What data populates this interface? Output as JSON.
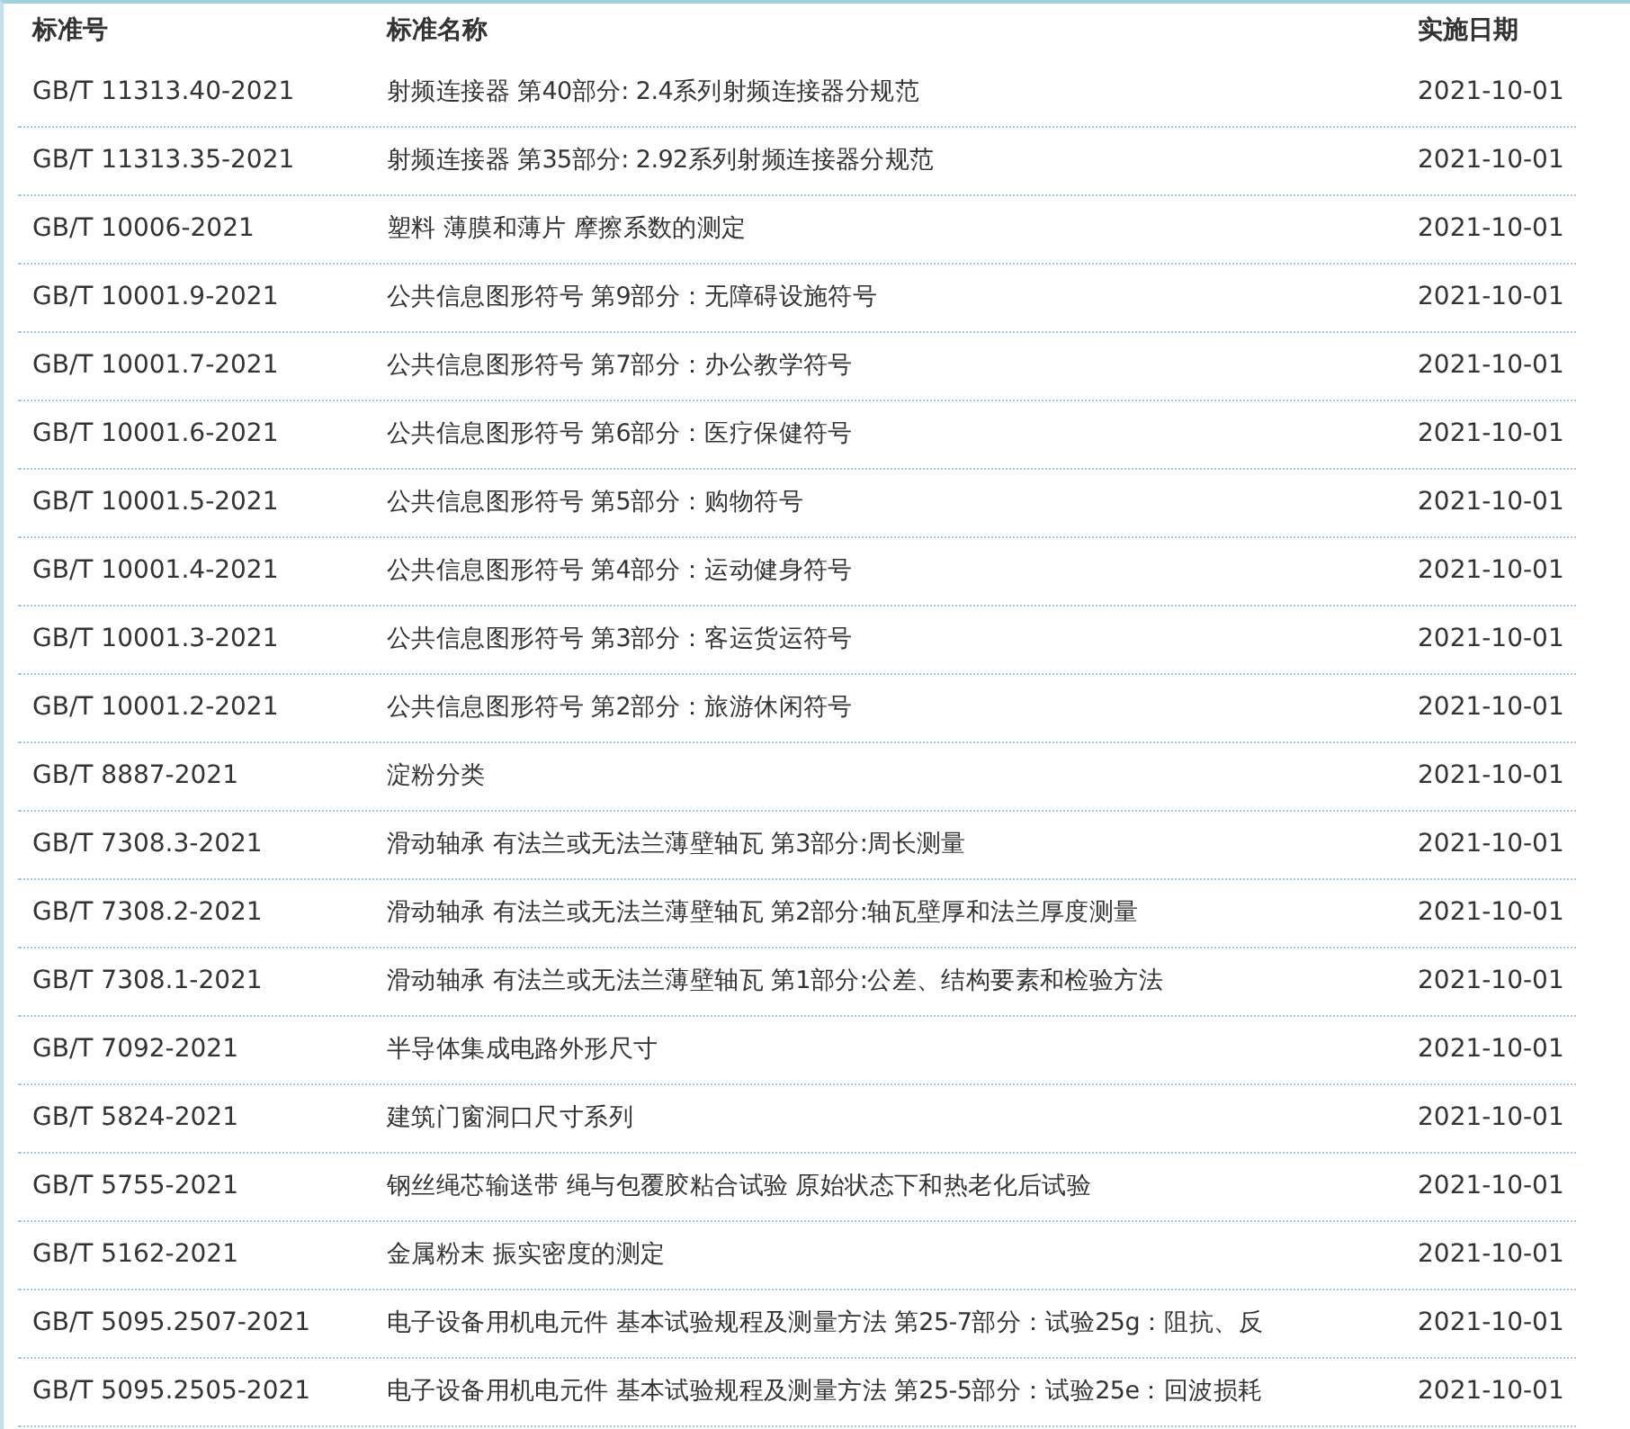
{
  "table": {
    "columns": [
      "标准号",
      "标准名称",
      "实施日期"
    ],
    "rows": [
      {
        "code": "GB/T 11313.40-2021",
        "name": "射频连接器 第40部分: 2.4系列射频连接器分规范",
        "date": "2021-10-01"
      },
      {
        "code": "GB/T 11313.35-2021",
        "name": "射频连接器 第35部分: 2.92系列射频连接器分规范",
        "date": "2021-10-01"
      },
      {
        "code": "GB/T 10006-2021",
        "name": "塑料 薄膜和薄片 摩擦系数的测定",
        "date": "2021-10-01"
      },
      {
        "code": "GB/T 10001.9-2021",
        "name": "公共信息图形符号 第9部分：无障碍设施符号",
        "date": "2021-10-01"
      },
      {
        "code": "GB/T 10001.7-2021",
        "name": "公共信息图形符号 第7部分：办公教学符号",
        "date": "2021-10-01"
      },
      {
        "code": "GB/T 10001.6-2021",
        "name": "公共信息图形符号 第6部分：医疗保健符号",
        "date": "2021-10-01"
      },
      {
        "code": "GB/T 10001.5-2021",
        "name": "公共信息图形符号 第5部分：购物符号",
        "date": "2021-10-01"
      },
      {
        "code": "GB/T 10001.4-2021",
        "name": "公共信息图形符号 第4部分：运动健身符号",
        "date": "2021-10-01"
      },
      {
        "code": "GB/T 10001.3-2021",
        "name": "公共信息图形符号 第3部分：客运货运符号",
        "date": "2021-10-01"
      },
      {
        "code": "GB/T 10001.2-2021",
        "name": "公共信息图形符号 第2部分：旅游休闲符号",
        "date": "2021-10-01"
      },
      {
        "code": "GB/T 8887-2021",
        "name": "淀粉分类",
        "date": "2021-10-01"
      },
      {
        "code": "GB/T 7308.3-2021",
        "name": "滑动轴承 有法兰或无法兰薄壁轴瓦 第3部分:周长测量",
        "date": "2021-10-01"
      },
      {
        "code": "GB/T 7308.2-2021",
        "name": "滑动轴承 有法兰或无法兰薄壁轴瓦 第2部分:轴瓦壁厚和法兰厚度测量",
        "date": "2021-10-01"
      },
      {
        "code": "GB/T 7308.1-2021",
        "name": "滑动轴承 有法兰或无法兰薄壁轴瓦 第1部分:公差、结构要素和检验方法",
        "date": "2021-10-01"
      },
      {
        "code": "GB/T 7092-2021",
        "name": "半导体集成电路外形尺寸",
        "date": "2021-10-01"
      },
      {
        "code": "GB/T 5824-2021",
        "name": "建筑门窗洞口尺寸系列",
        "date": "2021-10-01"
      },
      {
        "code": "GB/T 5755-2021",
        "name": "钢丝绳芯输送带 绳与包覆胶粘合试验 原始状态下和热老化后试验",
        "date": "2021-10-01"
      },
      {
        "code": "GB/T 5162-2021",
        "name": "金属粉末 振实密度的测定",
        "date": "2021-10-01"
      },
      {
        "code": "GB/T 5095.2507-2021",
        "name": "电子设备用机电元件 基本试验规程及测量方法 第25-7部分：试验25g：阻抗、反",
        "date": "2021-10-01"
      },
      {
        "code": "GB/T 5095.2505-2021",
        "name": "电子设备用机电元件 基本试验规程及测量方法 第25-5部分：试验25e：回波损耗",
        "date": "2021-10-01"
      }
    ]
  }
}
